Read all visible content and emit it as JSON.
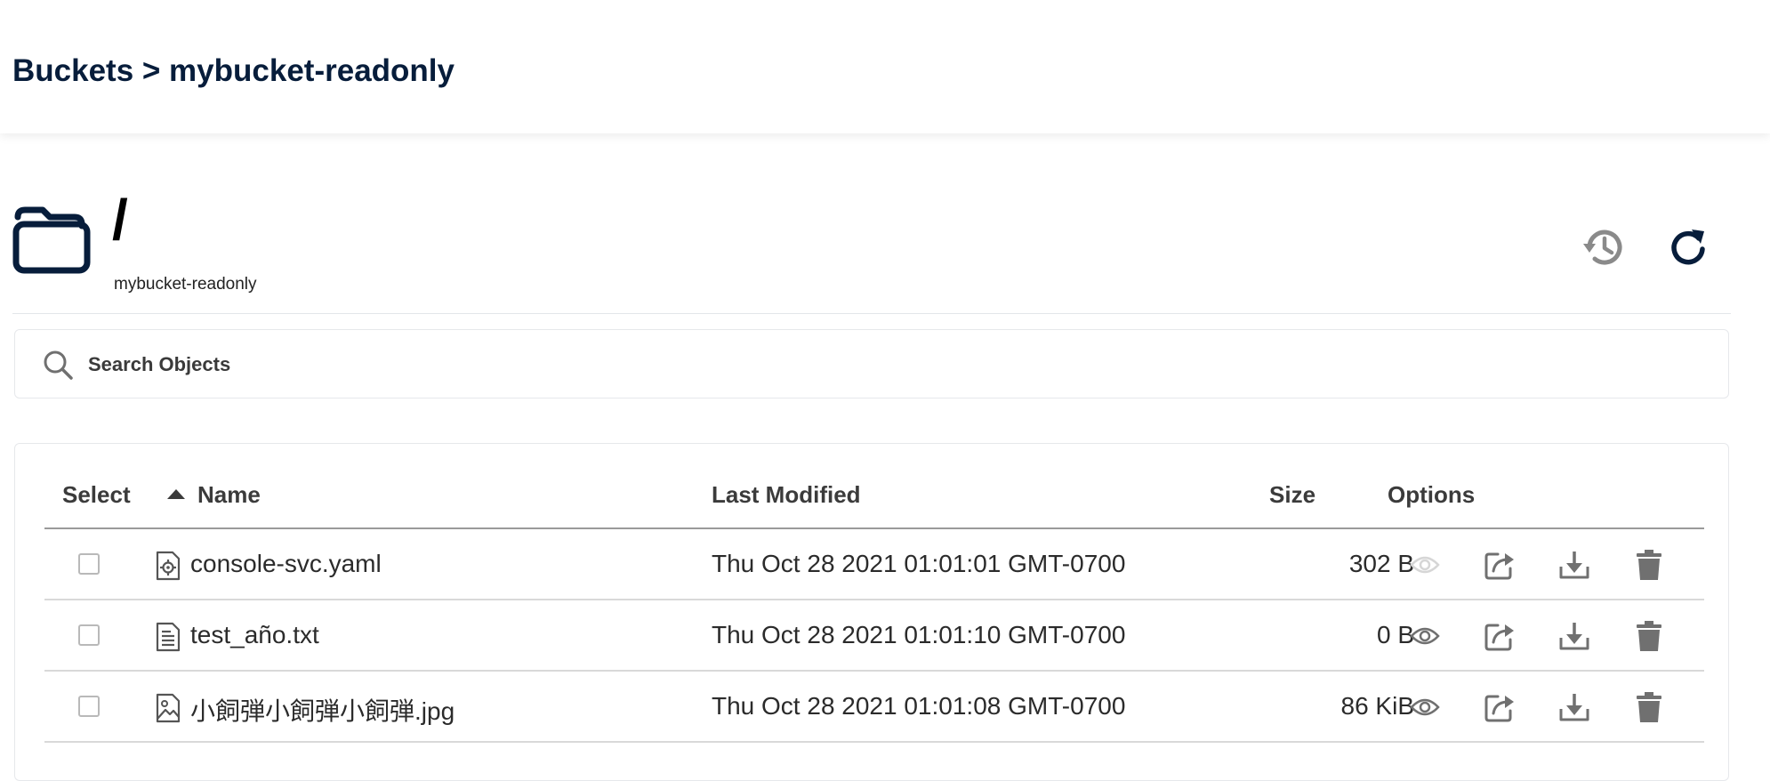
{
  "breadcrumb": "Buckets > mybucket-readonly",
  "folder": {
    "path": "/",
    "bucket_name": "mybucket-readonly"
  },
  "search": {
    "placeholder": "Search Objects",
    "value": ""
  },
  "table": {
    "headers": {
      "select": "Select",
      "name": "Name",
      "last_modified": "Last Modified",
      "size": "Size",
      "options": "Options"
    },
    "sort": {
      "column": "Name",
      "direction": "ascending"
    },
    "rows": [
      {
        "name": "console-svc.yaml",
        "icon": "config-file-icon",
        "last_modified": "Thu Oct 28 2021 01:01:01 GMT-0700",
        "size": "302 B",
        "preview_enabled": false,
        "selected": false
      },
      {
        "name": "test_año.txt",
        "icon": "text-file-icon",
        "last_modified": "Thu Oct 28 2021 01:01:10 GMT-0700",
        "size": "0 B",
        "preview_enabled": true,
        "selected": false
      },
      {
        "name": "小飼弾小飼弾小飼弾.jpg",
        "icon": "image-file-icon",
        "last_modified": "Thu Oct 28 2021 01:01:08 GMT-0700",
        "size": "86 KiB",
        "preview_enabled": true,
        "selected": false
      }
    ]
  },
  "colors": {
    "primary": "#071d3b",
    "icon_gray": "#707070",
    "disabled": "#d6d6d6"
  }
}
